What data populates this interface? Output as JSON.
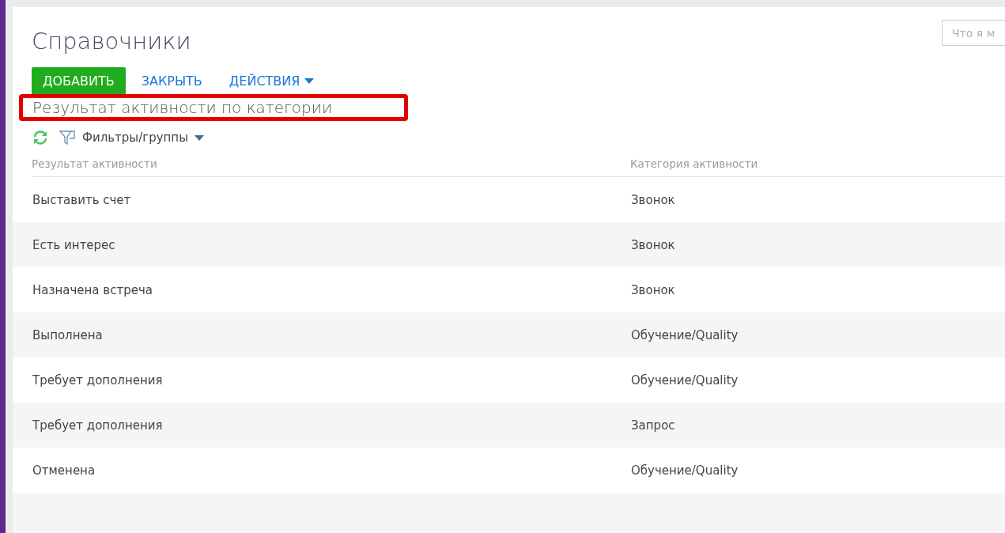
{
  "page_title": "Справочники",
  "search": {
    "placeholder": "Что я м"
  },
  "actions": [
    {
      "label": "ДОБАВИТЬ",
      "kind": "primary"
    },
    {
      "label": "ЗАКРЫТЬ",
      "kind": "link"
    },
    {
      "label": "ДЕЙСТВИЯ",
      "kind": "dropdown"
    }
  ],
  "section_title": {
    "text": "Результат активности по категории",
    "highlighted": true
  },
  "toolbar": {
    "filter_label": "Фильтры/группы"
  },
  "table": {
    "columns": [
      "Результат активности",
      "Категория активности"
    ],
    "rows": [
      [
        "Выставить счет",
        "Звонок"
      ],
      [
        "Есть интерес",
        "Звонок"
      ],
      [
        "Назначена встреча",
        "Звонок"
      ],
      [
        "Выполнена",
        "Обучение/Quality"
      ],
      [
        "Требует дополнения",
        "Обучение/Quality"
      ],
      [
        "Требует дополнения",
        "Запрос"
      ],
      [
        "Отменена",
        "Обучение/Quality"
      ]
    ]
  }
}
